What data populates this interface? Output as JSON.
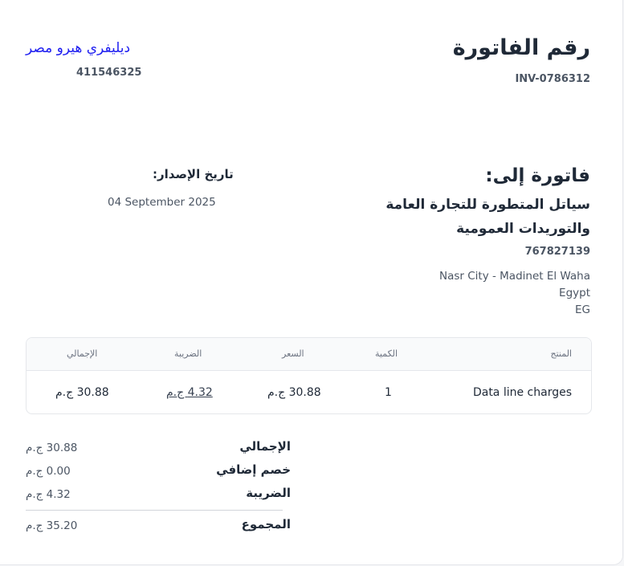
{
  "header": {
    "invoice_title": "رقم الفاتورة",
    "invoice_number": "INV-0786312",
    "company_name": "ديليفري هيرو مصر",
    "company_id": "411546325"
  },
  "bill_to": {
    "label": "فاتورة إلى:",
    "name": "سياتل المتطورة للتجارة العامة والتوريدات العمومية",
    "id": "767827139",
    "address_line1": "Nasr City - Madinet El Waha",
    "address_line2": "Egypt",
    "address_line3": "EG"
  },
  "issue": {
    "label": "تاريخ الإصدار:",
    "date": "04 September 2025"
  },
  "table": {
    "headers": {
      "product": "المنتج",
      "quantity": "الكمية",
      "price": "السعر",
      "tax": "الضريبة",
      "total": "الإجمالي"
    },
    "rows": [
      {
        "product": "Data line charges",
        "quantity": "1",
        "price": "30.88 ج.م",
        "tax": "4.32 ج.م",
        "total": "30.88 ج.م"
      }
    ]
  },
  "totals": {
    "subtotal_label": "الإجمالي",
    "subtotal_value": "30.88 ج.م",
    "discount_label": "خصم إضافي",
    "discount_value": "0.00 ج.م",
    "tax_label": "الضريبة",
    "tax_value": "4.32 ج.م",
    "grand_label": "المجموع",
    "grand_value": "35.20 ج.م"
  }
}
